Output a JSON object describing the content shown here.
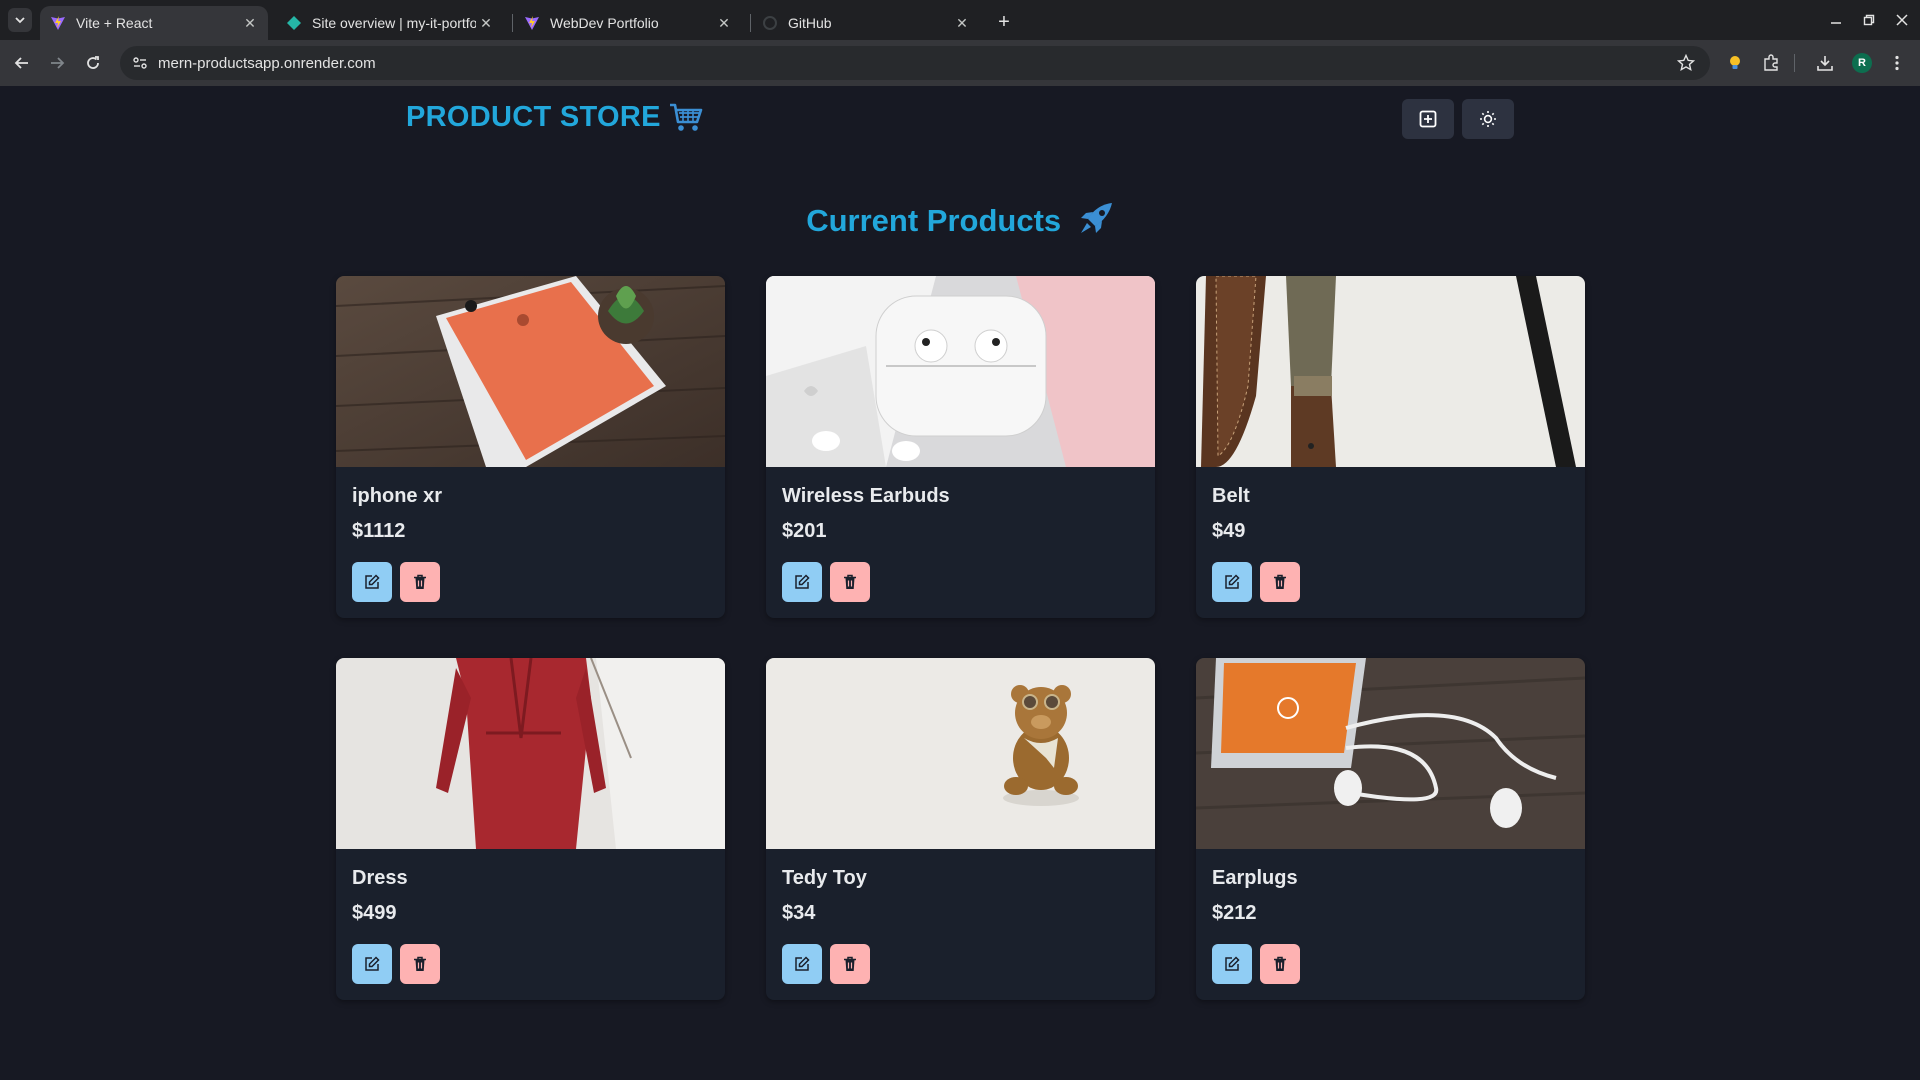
{
  "browser": {
    "tabs": [
      {
        "title": "Vite + React",
        "active": true,
        "favicon": "vite-icon"
      },
      {
        "title": "Site overview | my-it-portfo",
        "active": false,
        "favicon": "netlify-icon"
      },
      {
        "title": "WebDev Portfolio",
        "active": false,
        "favicon": "vite-icon"
      },
      {
        "title": "GitHub",
        "active": false,
        "favicon": "github-loading-icon"
      }
    ],
    "url": "mern-productsapp.onrender.com",
    "profile_initial": "R"
  },
  "header": {
    "brand": "PRODUCT STORE",
    "brand_icon": "cart-icon",
    "create_button_icon": "plus-square-icon",
    "theme_button_icon": "sun-icon"
  },
  "main": {
    "title": "Current Products",
    "title_icon": "rocket-icon",
    "products": [
      {
        "name": "iphone xr",
        "price": "$1112",
        "image": "orange-iphone-in-box-on-wood"
      },
      {
        "name": "Wireless Earbuds",
        "price": "$201",
        "image": "white-earbuds-case-on-pink"
      },
      {
        "name": "Belt",
        "price": "$49",
        "image": "leather-belt-on-white-wall"
      },
      {
        "name": "Dress",
        "price": "$499",
        "image": "red-dress-on-hanger"
      },
      {
        "name": "Tedy Toy",
        "price": "$34",
        "image": "teddy-bear-with-goggles"
      },
      {
        "name": "Earplugs",
        "price": "$212",
        "image": "phone-with-white-earphones-on-wood"
      }
    ]
  },
  "colors": {
    "accent": "#22a7db",
    "page_bg": "#171923",
    "card_bg": "#1a202c",
    "edit_button": "#90cdf4",
    "delete_button": "#feb2b2"
  }
}
